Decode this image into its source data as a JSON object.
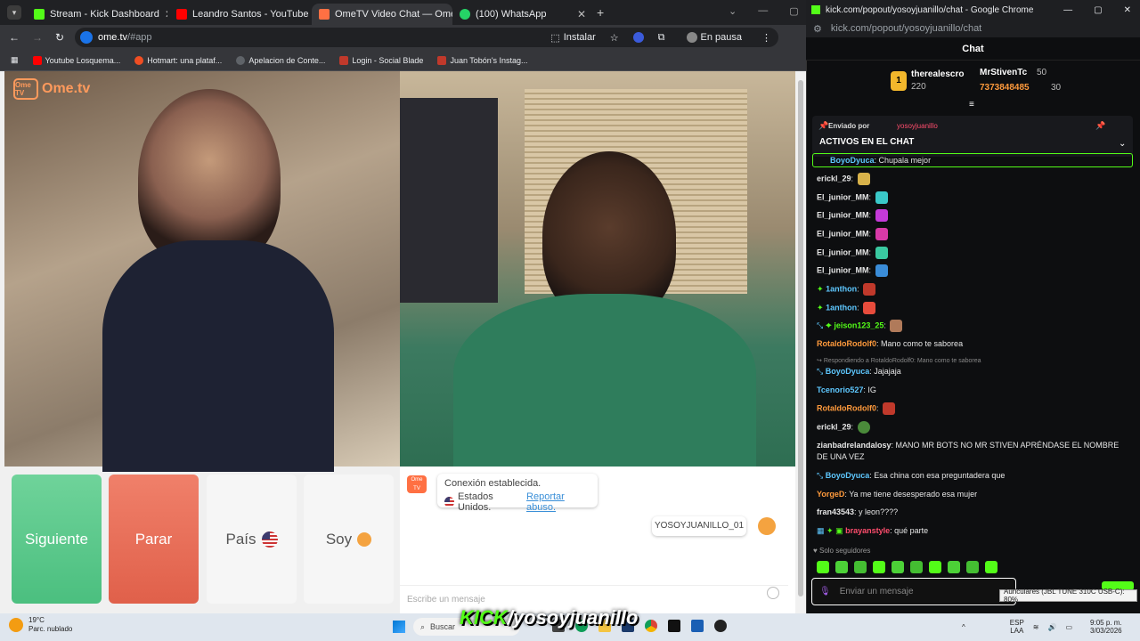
{
  "tabs": [
    {
      "title": "Stream - Kick Dashboard",
      "color": "#53fc18"
    },
    {
      "title": "Leandro Santos - YouTube",
      "color": "#ff0000"
    },
    {
      "title": "OmeTV Video Chat — Ome",
      "color": "#ff7043"
    },
    {
      "title": "(100) WhatsApp",
      "color": "#25d366"
    }
  ],
  "address": {
    "domain": "ome.tv",
    "path": "/#app"
  },
  "toolbar": {
    "install": "Instalar",
    "profile": "En pausa"
  },
  "bookmarks": [
    {
      "label": "Youtube Losquema...",
      "color": "#ff0000"
    },
    {
      "label": "Hotmart: una plataf...",
      "color": "#f04e23"
    },
    {
      "label": "Apelacion de Conte...",
      "color": "#5f6368"
    },
    {
      "label": "Login - Social Blade",
      "color": "#c0392b"
    },
    {
      "label": "Juan Tobón's Instag...",
      "color": "#c0392b"
    }
  ],
  "ome": {
    "logo": "Ome.tv",
    "logo_badge": "Ome TV",
    "buttons": {
      "next": "Siguiente",
      "stop": "Parar",
      "country": "País",
      "me": "Soy"
    },
    "connection": "Conexión establecida.",
    "country_text": "Estados Unidos.",
    "report": "Reportar abuso.",
    "username": "YOSOYJUANILLO_01",
    "message_placeholder": "Escribe un mensaje"
  },
  "rwin": {
    "title": "kick.com/popout/yosoyjuanillo/chat - Google Chrome",
    "url": "kick.com/popout/yosoyjuanillo/chat",
    "chat_title": "Chat",
    "top1_name": "therealescro",
    "top1_score": "220",
    "top2_name": "MrStivenTc",
    "top2_score": "50",
    "top3_name": "7373848485",
    "top3_score": "30",
    "pinned_by": "Enviado por",
    "pinned_user": "yosoyjuanillo",
    "pinned_text": "ACTIVOS EN EL CHAT",
    "followers_only": "Solo seguidores",
    "input_placeholder": "Enviar un mensaje"
  },
  "messages": [
    {
      "user": "BoyoDyuca",
      "text": "Chupala  mejor",
      "color": "#53fc18"
    },
    {
      "user": "erickl_29",
      "text": "",
      "color": "#ffffff"
    },
    {
      "user": "El_junior_MM",
      "text": "",
      "color": "#ffffff"
    },
    {
      "user": "El_junior_MM",
      "text": "",
      "color": "#ffffff"
    },
    {
      "user": "El_junior_MM",
      "text": "",
      "color": "#ffffff"
    },
    {
      "user": "El_junior_MM",
      "text": "",
      "color": "#ffffff"
    },
    {
      "user": "El_junior_MM",
      "text": "",
      "color": "#ffffff"
    },
    {
      "user": "1anthon",
      "text": "",
      "color": "#53fc18"
    },
    {
      "user": "1anthon",
      "text": "",
      "color": "#53fc18"
    },
    {
      "user": "jeison123_25",
      "text": "",
      "color": "#53fc18"
    },
    {
      "user": "RotaldoRodolf0",
      "text": "Mano como te saborea",
      "color": "#ff9a3c"
    },
    {
      "user": "BoyoDyuca",
      "text": "Jajajaja",
      "color": "#5ec8ff"
    },
    {
      "user": "Tcenorio527",
      "text": "IG",
      "color": "#5ec8ff"
    },
    {
      "user": "RotaldoRodolf0",
      "text": "",
      "color": "#ff9a3c"
    },
    {
      "user": "erickl_29",
      "text": "",
      "color": "#ffffff"
    },
    {
      "user": "zianbadrelandalosy",
      "text": "MANO MR BOTS NO MR STIVEN APRÉNDASE EL NOMBRE DE UNA VEZ",
      "color": "#ffffff"
    },
    {
      "user": "BoyoDyuca",
      "text": "Esa china con esa preguntadera que",
      "color": "#5ec8ff"
    },
    {
      "user": "YorgeD",
      "text": "Ya me tiene desesperado esa mujer",
      "color": "#ff9a3c"
    },
    {
      "user": "fran43543",
      "text": "y leon????",
      "color": "#ffffff"
    },
    {
      "user": "brayanstyle",
      "text": "qué parte",
      "color": "#ff4d6d"
    }
  ],
  "reply_note": "Respondiendo a RotaldoRodolf0: Mano como te saborea",
  "taskbar": {
    "temp": "19°C",
    "weather": "Parc. nublado",
    "search": "Buscar",
    "lang": "ESP",
    "lang2": "LAA",
    "time": "9:05 p. m.",
    "date": "3/03/2026"
  },
  "tooltip": "Auriculares (JBL TUNE 310C USB-C): 80%",
  "overlay_kick": "KICK",
  "overlay_user": "/yosoyjuanillo"
}
